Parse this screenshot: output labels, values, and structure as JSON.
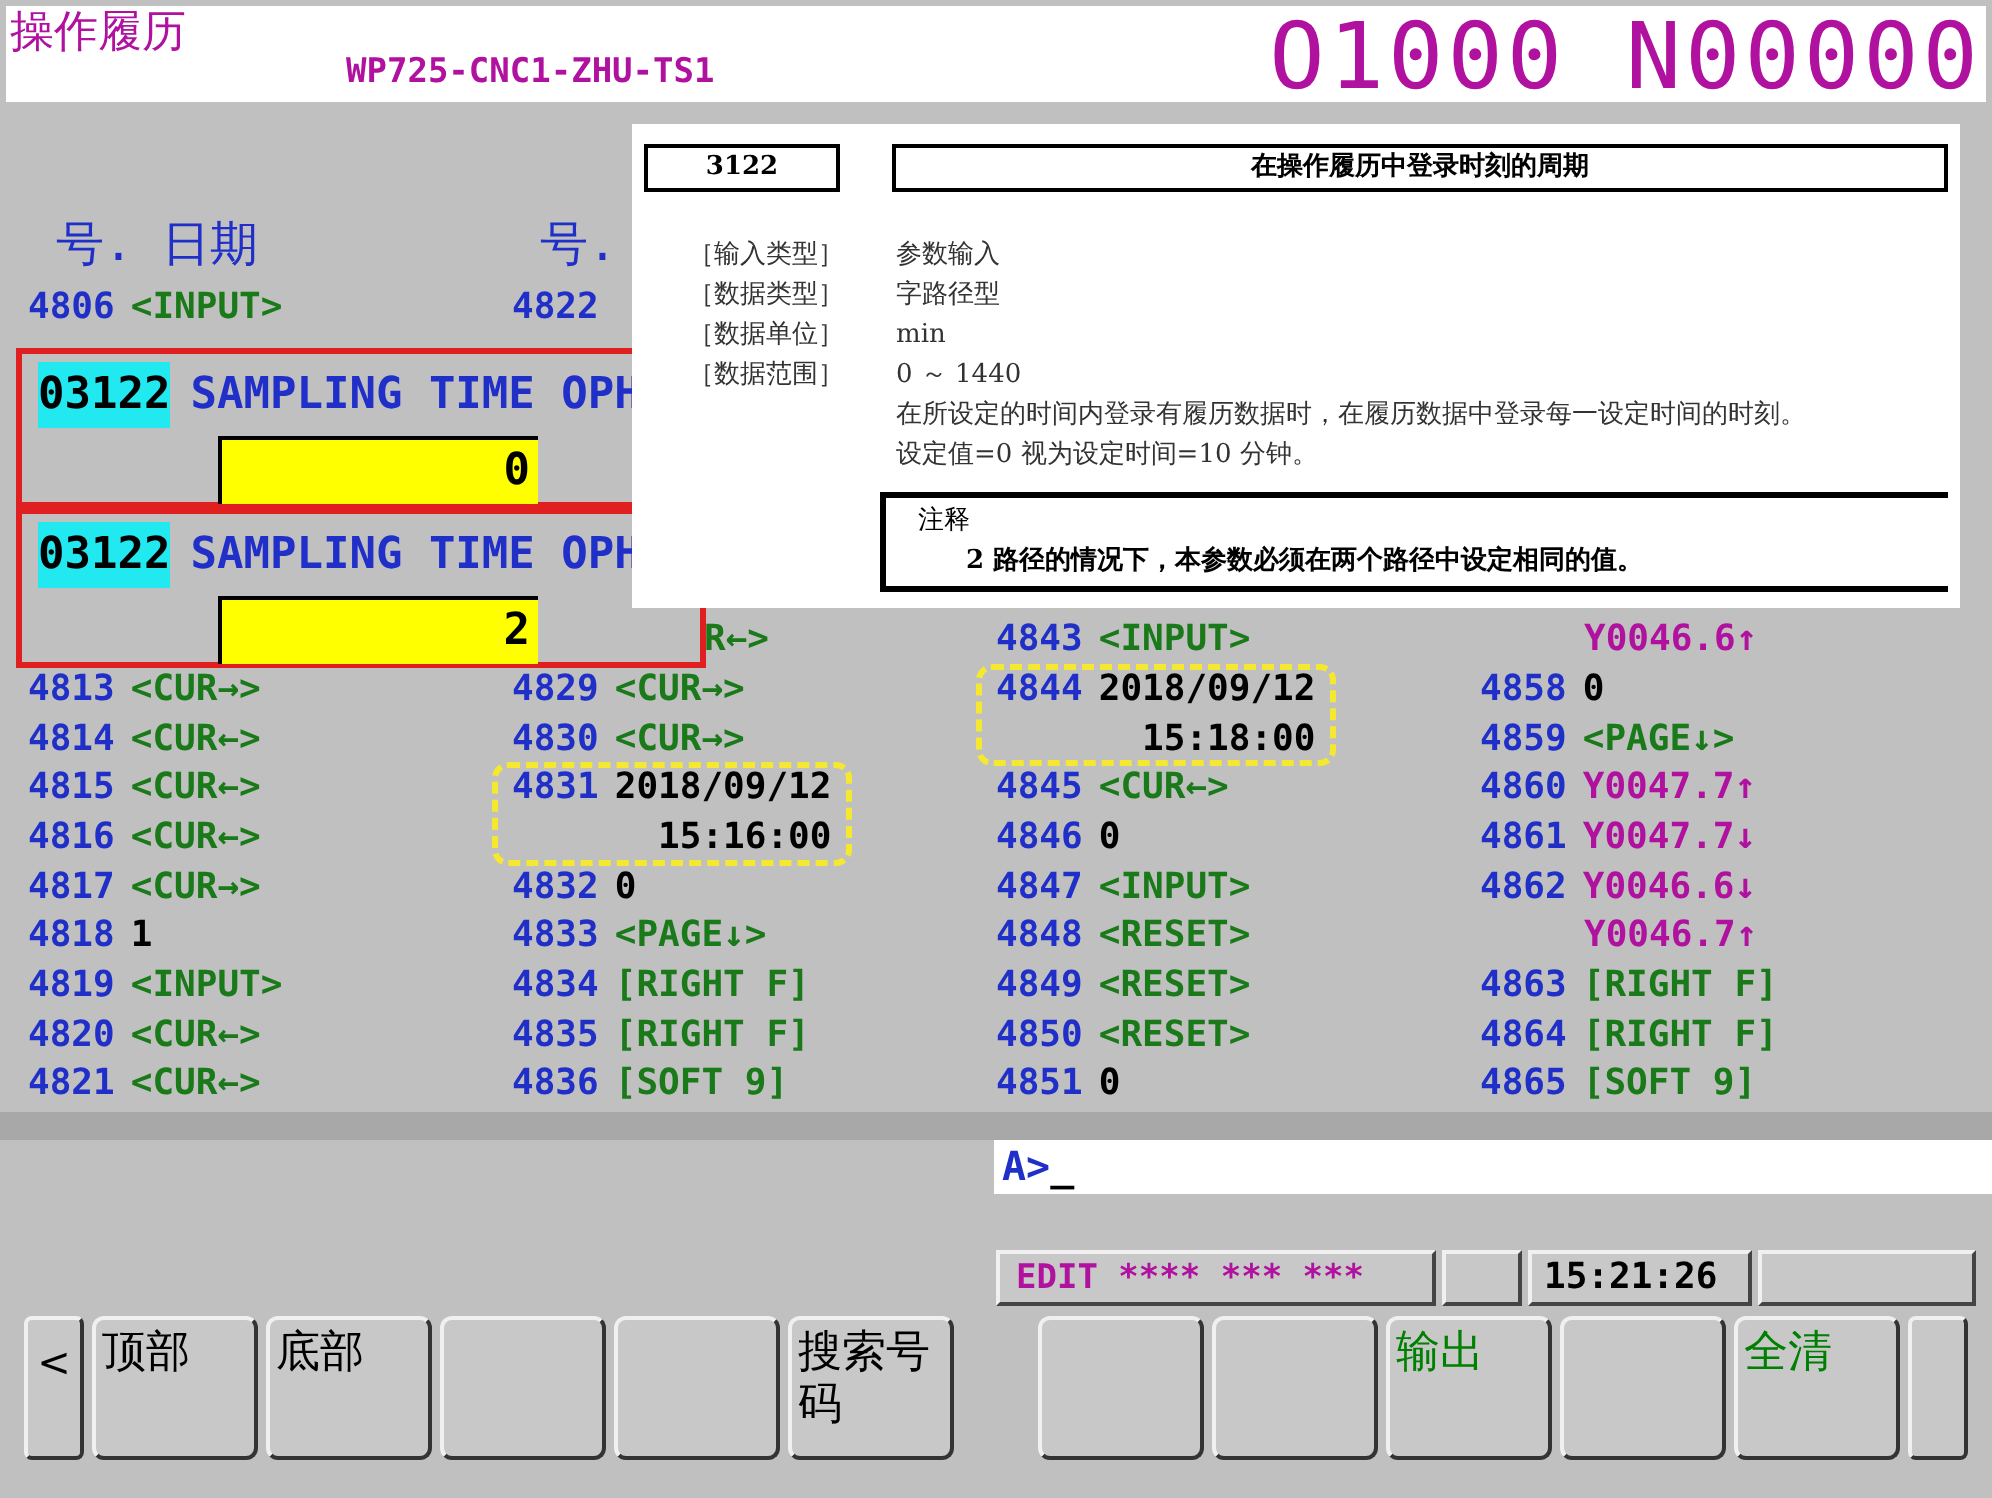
{
  "header": {
    "title": "操作履历",
    "machine": "WP725-CNC1-ZHU-TS1",
    "program": "O1000 N00000"
  },
  "columns": [
    {
      "heading": "号. 日期",
      "top_rows": [
        {
          "kind": "entry",
          "no": "4806",
          "value": "<INPUT>",
          "color": "#1a7a1a"
        }
      ],
      "rows": [
        {
          "kind": "entry",
          "no": "4813",
          "value": "<CUR→>",
          "color": "#1a7a1a"
        },
        {
          "kind": "entry",
          "no": "4814",
          "value": "<CUR←>",
          "color": "#1a7a1a"
        },
        {
          "kind": "entry",
          "no": "4815",
          "value": "<CUR←>",
          "color": "#1a7a1a"
        },
        {
          "kind": "entry",
          "no": "4816",
          "value": "<CUR←>",
          "color": "#1a7a1a"
        },
        {
          "kind": "entry",
          "no": "4817",
          "value": "<CUR→>",
          "color": "#1a7a1a"
        },
        {
          "kind": "entry",
          "no": "4818",
          "value": "1",
          "color": "#000000"
        },
        {
          "kind": "entry",
          "no": "4819",
          "value": "<INPUT>",
          "color": "#1a7a1a"
        },
        {
          "kind": "entry",
          "no": "4820",
          "value": "<CUR←>",
          "color": "#1a7a1a"
        },
        {
          "kind": "entry",
          "no": "4821",
          "value": "<CUR←>",
          "color": "#1a7a1a"
        }
      ]
    },
    {
      "heading": "号.",
      "top_rows": [
        {
          "kind": "entry",
          "no": "4822"
        }
      ],
      "rows": [
        {
          "kind": "fragment",
          "value": "R←>",
          "color": "#1a7a1a"
        },
        {
          "kind": "entry",
          "no": "4829",
          "value": "<CUR→>",
          "color": "#1a7a1a"
        },
        {
          "kind": "entry",
          "no": "4830",
          "value": "<CUR→>",
          "color": "#1a7a1a"
        },
        {
          "kind": "datetime",
          "no": "4831",
          "date": "2018/09/12",
          "time": "15:16:00",
          "highlighted": true
        },
        {
          "kind": "entry",
          "no": "4832",
          "value": "0",
          "color": "#000000"
        },
        {
          "kind": "entry",
          "no": "4833",
          "value": "<PAGE↓>",
          "color": "#1a7a1a"
        },
        {
          "kind": "entry",
          "no": "4834",
          "value": "[RIGHT F]",
          "color": "#1a7a1a"
        },
        {
          "kind": "entry",
          "no": "4835",
          "value": "[RIGHT F]",
          "color": "#1a7a1a"
        },
        {
          "kind": "entry",
          "no": "4836",
          "value": "[SOFT 9]",
          "color": "#1a7a1a"
        }
      ]
    },
    {
      "rows": [
        {
          "kind": "entry",
          "no": "4843",
          "value": "<INPUT>",
          "color": "#1a7a1a"
        },
        {
          "kind": "datetime",
          "no": "4844",
          "date": "2018/09/12",
          "time": "15:18:00",
          "highlighted": true
        },
        {
          "kind": "entry",
          "no": "4845",
          "value": "<CUR←>",
          "color": "#1a7a1a"
        },
        {
          "kind": "entry",
          "no": "4846",
          "value": "0",
          "color": "#000000"
        },
        {
          "kind": "entry",
          "no": "4847",
          "value": "<INPUT>",
          "color": "#1a7a1a"
        },
        {
          "kind": "entry",
          "no": "4848",
          "value": "<RESET>",
          "color": "#1a7a1a"
        },
        {
          "kind": "entry",
          "no": "4849",
          "value": "<RESET>",
          "color": "#1a7a1a"
        },
        {
          "kind": "entry",
          "no": "4850",
          "value": "<RESET>",
          "color": "#1a7a1a"
        },
        {
          "kind": "entry",
          "no": "4851",
          "value": "0",
          "color": "#000000"
        }
      ]
    },
    {
      "rows": [
        {
          "kind": "continuation",
          "value": "Y0046.6↑",
          "color": "#b0119f"
        },
        {
          "kind": "entry",
          "no": "4858",
          "value": "0",
          "color": "#000000"
        },
        {
          "kind": "entry",
          "no": "4859",
          "value": "<PAGE↓>",
          "color": "#1a7a1a"
        },
        {
          "kind": "entry",
          "no": "4860",
          "value": "Y0047.7↑",
          "color": "#b0119f"
        },
        {
          "kind": "entry",
          "no": "4861",
          "value": "Y0047.7↓",
          "color": "#b0119f"
        },
        {
          "kind": "entry",
          "no": "4862",
          "value": "Y0046.6↓",
          "color": "#b0119f"
        },
        {
          "kind": "continuation",
          "value": "Y0046.7↑",
          "color": "#b0119f"
        },
        {
          "kind": "entry",
          "no": "4863",
          "value": "[RIGHT F]",
          "color": "#1a7a1a"
        },
        {
          "kind": "entry",
          "no": "4864",
          "value": "[RIGHT F]",
          "color": "#1a7a1a"
        },
        {
          "kind": "entry",
          "no": "4865",
          "value": "[SOFT 9]",
          "color": "#1a7a1a"
        }
      ]
    }
  ],
  "parameter_popups": [
    {
      "number": "03122",
      "name": "SAMPLING TIME OPH",
      "value": "0"
    },
    {
      "number": "03122",
      "name": "SAMPLING TIME OPH",
      "value": "2"
    }
  ],
  "manual_page": {
    "number": "3122",
    "title": "在操作履历中登录时刻的周期",
    "fields": [
      {
        "label": "［输入类型］",
        "value": "参数输入"
      },
      {
        "label": "［数据类型］",
        "value": "字路径型"
      },
      {
        "label": "［数据单位］",
        "value": "min"
      },
      {
        "label": "［数据范围］",
        "value": "0 ～ 1440"
      }
    ],
    "description": [
      "在所设定的时间内登录有履历数据时，在履历数据中登录每一设定时间的时刻。",
      "设定值=0 视为设定时间=10 分钟。"
    ],
    "note": {
      "title": "注释",
      "text": "2 路径的情况下，本参数必须在两个路径中设定相同的值。"
    }
  },
  "input_line": {
    "prompt": "A>",
    "cursor": "_"
  },
  "status_bar": {
    "mode": "EDIT **** *** ***",
    "time": "15:21:26"
  },
  "softkeys_left": [
    {
      "kind": "arrow",
      "label": "<"
    },
    {
      "kind": "key",
      "label": "顶部"
    },
    {
      "kind": "key",
      "label": "底部"
    },
    {
      "kind": "key"
    },
    {
      "kind": "key"
    },
    {
      "kind": "key",
      "label": "搜索号码"
    }
  ],
  "softkeys_right": [
    {
      "kind": "key"
    },
    {
      "kind": "key"
    },
    {
      "kind": "key",
      "label": "输出",
      "color": "#008000"
    },
    {
      "kind": "key"
    },
    {
      "kind": "key",
      "label": "全清",
      "color": "#008000"
    },
    {
      "kind": "arrow"
    }
  ]
}
